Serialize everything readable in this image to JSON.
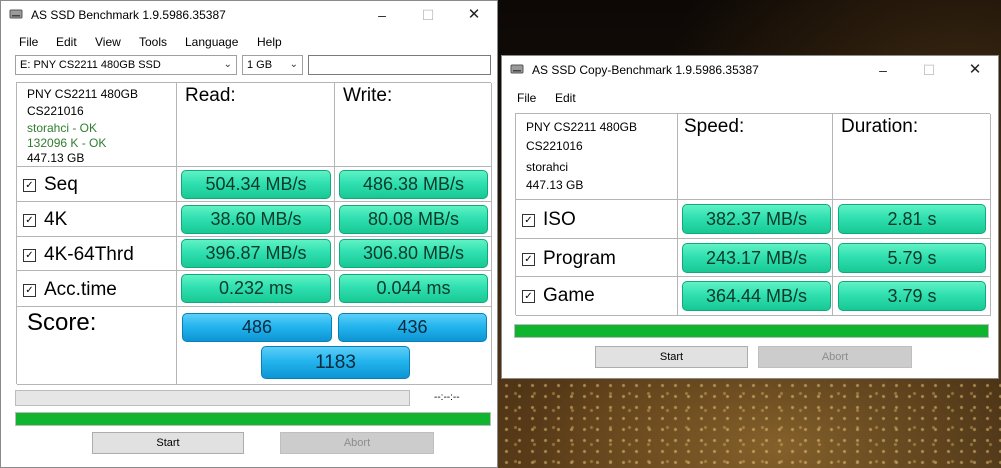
{
  "main": {
    "title": "AS SSD Benchmark 1.9.5986.35387",
    "menu": [
      "File",
      "Edit",
      "View",
      "Tools",
      "Language",
      "Help"
    ],
    "drive_select": "E: PNY CS2211 480GB SSD",
    "size_select": "1 GB",
    "extra_input": "",
    "info": {
      "model": "PNY CS2211 480GB",
      "firmware": "CS221016",
      "driver": "storahci - OK",
      "alignment": "132096 K - OK",
      "capacity": "447.13 GB"
    },
    "headers": {
      "read": "Read:",
      "write": "Write:"
    },
    "rows": [
      {
        "label": "Seq",
        "read": "504.34 MB/s",
        "write": "486.38 MB/s"
      },
      {
        "label": "4K",
        "read": "38.60 MB/s",
        "write": "80.08 MB/s"
      },
      {
        "label": "4K-64Thrd",
        "read": "396.87 MB/s",
        "write": "306.80 MB/s"
      },
      {
        "label": "Acc.time",
        "read": "0.232 ms",
        "write": "0.044 ms"
      }
    ],
    "score": {
      "label": "Score:",
      "read": "486",
      "write": "436",
      "total": "1183"
    },
    "time_display": "--:--:--",
    "progress_fraction": 1.0,
    "buttons": {
      "start": "Start",
      "abort": "Abort"
    }
  },
  "copy": {
    "title": "AS SSD Copy-Benchmark 1.9.5986.35387",
    "menu": [
      "File",
      "Edit"
    ],
    "info": {
      "model": "PNY CS2211 480GB",
      "firmware": "CS221016",
      "driver": "storahci",
      "capacity": "447.13 GB"
    },
    "headers": {
      "speed": "Speed:",
      "duration": "Duration:"
    },
    "rows": [
      {
        "label": "ISO",
        "speed": "382.37 MB/s",
        "duration": "2.81 s"
      },
      {
        "label": "Program",
        "speed": "243.17 MB/s",
        "duration": "5.79 s"
      },
      {
        "label": "Game",
        "speed": "364.44 MB/s",
        "duration": "3.79 s"
      }
    ],
    "progress_fraction": 1.0,
    "buttons": {
      "start": "Start",
      "abort": "Abort"
    }
  },
  "icons": {
    "app": "disk-drive-icon",
    "checkbox": "checkmark-icon",
    "dropdown": "chevron-down-icon"
  },
  "colors": {
    "value_green": "#30e0b0",
    "score_blue": "#24b5ee",
    "progress_green": "#0fb52e",
    "ok_text": "#2f7d2f"
  }
}
